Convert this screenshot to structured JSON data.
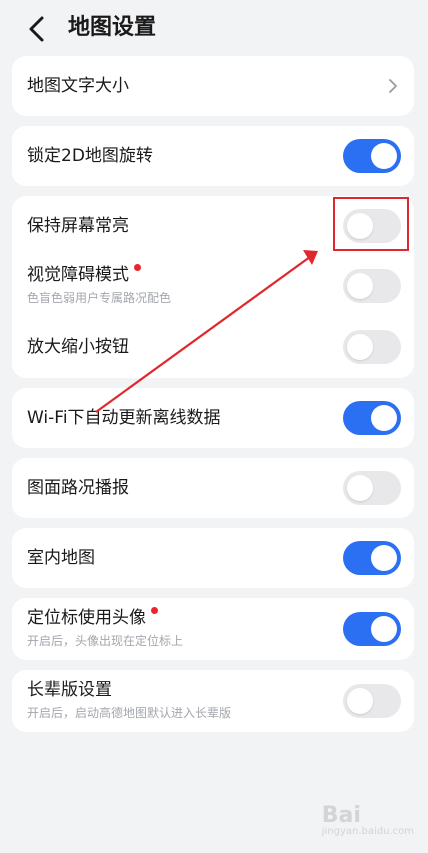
{
  "header": {
    "title": "地图设置",
    "back_icon": "chevron-left-icon"
  },
  "settings": {
    "font_size": {
      "label": "地图文字大小",
      "icon": "chevron-right-icon"
    },
    "lock_2d": {
      "label": "锁定2D地图旋转",
      "enabled": true
    },
    "screen_on": {
      "label": "保持屏幕常亮",
      "enabled": false
    },
    "visual_mode": {
      "label": "视觉障碍模式",
      "sublabel": "色盲色弱用户专属路况配色",
      "enabled": false,
      "badge": "red-dot"
    },
    "zoom_buttons": {
      "label": "放大缩小按钮",
      "enabled": false
    },
    "wifi_update": {
      "label": "Wi-Fi下自动更新离线数据",
      "enabled": true
    },
    "traffic_broadcast": {
      "label": "图面路况播报",
      "enabled": false
    },
    "indoor_map": {
      "label": "室内地图",
      "enabled": true
    },
    "avatar_marker": {
      "label": "定位标使用头像",
      "sublabel": "开启后，头像出现在定位标上",
      "enabled": true,
      "badge": "red-dot"
    },
    "elder_mode": {
      "label": "长辈版设置",
      "sublabel": "开启后，启动高德地图默认进入长辈版",
      "enabled": false
    }
  },
  "annotation": {
    "color": "#e0272d"
  },
  "colors": {
    "toggle_on": "#2b6ff2",
    "toggle_off": "#e8e8ea",
    "background": "#f2f3f5"
  },
  "watermark": {
    "text": "Bai",
    "subtext": "jingyan.baidu.com"
  }
}
